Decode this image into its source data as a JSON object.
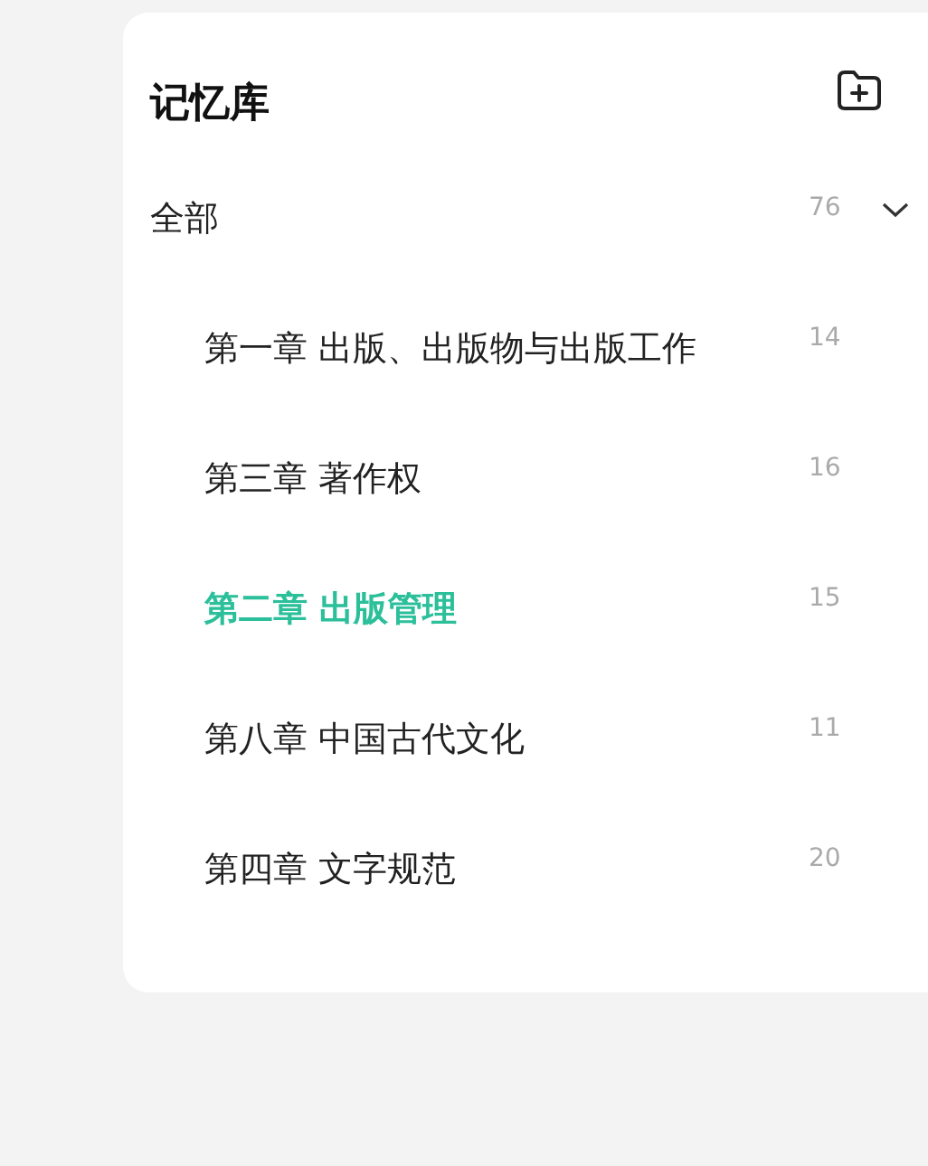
{
  "panel": {
    "title": "记忆库"
  },
  "tree": {
    "label": "全部",
    "count": "76",
    "expanded": true,
    "selected": false,
    "children": [
      {
        "label": "第一章 出版、出版物与出版工作",
        "count": "14",
        "selected": false
      },
      {
        "label": "第三章 著作权",
        "count": "16",
        "selected": false
      },
      {
        "label": "第二章 出版管理",
        "count": "15",
        "selected": true
      },
      {
        "label": "第八章 中国古代文化",
        "count": "11",
        "selected": false
      },
      {
        "label": "第四章 文字规范",
        "count": "20",
        "selected": false
      }
    ]
  }
}
